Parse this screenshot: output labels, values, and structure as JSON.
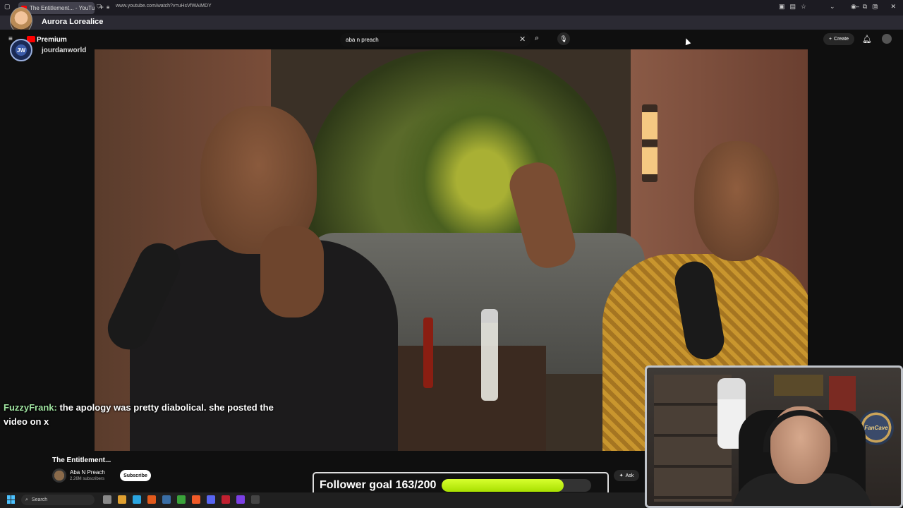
{
  "browser": {
    "tab_title": "The Entitlement... - YouTub",
    "url": "www.youtube.com/watch?v=uHsVfWAiMDY",
    "window_controls": [
      "–",
      "▢",
      "✕"
    ]
  },
  "streamer_overlay": {
    "name": "Aurora Lorealice"
  },
  "youtube": {
    "premium_label": "Premium",
    "channel_overlay_name": "jourdanworld",
    "search_query": "aba n preach",
    "create_label": "Create",
    "video_title": "The Entitlement...",
    "channel_title": "Aba N Preach",
    "subscribers": "2.26M subscribers",
    "subscribe_label": "Subscribe",
    "ask_label": "Ask"
  },
  "chat": {
    "user": "FuzzyFrank:",
    "message": " the apology was pretty diabolical. she posted the video on x"
  },
  "follower_goal": {
    "label": "Follower goal 163/200",
    "current": 163,
    "target": 200
  },
  "webcam": {
    "poster_text": "FanCave"
  },
  "taskbar": {
    "search_placeholder": "Search"
  },
  "colors": {
    "yt_red": "#ff0000",
    "goal_fill": "#c8f51a",
    "chat_user": "#9fe3a0"
  }
}
